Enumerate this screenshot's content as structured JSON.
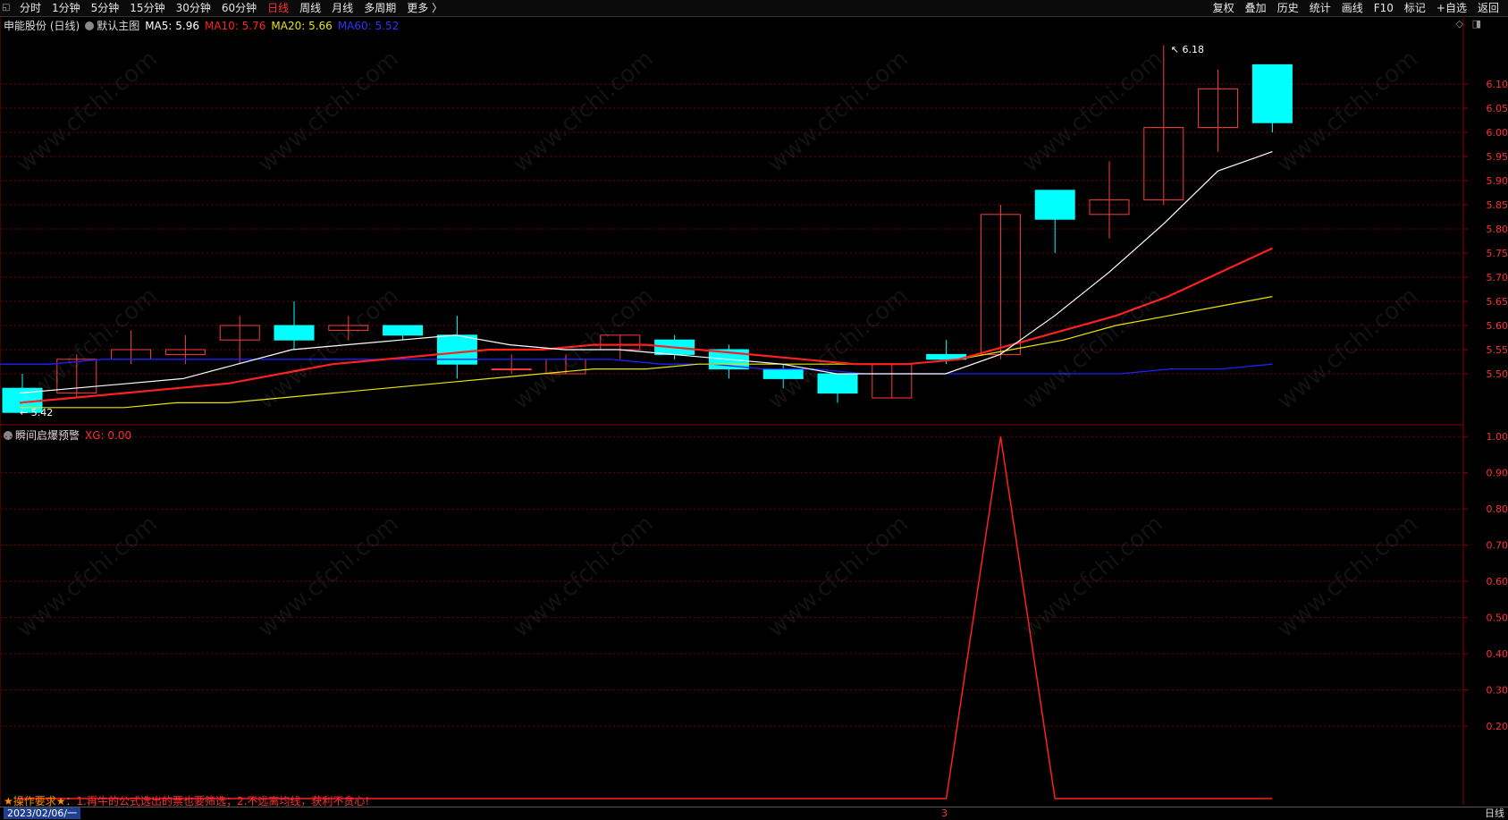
{
  "toolbar": {
    "periods": [
      "分时",
      "1分钟",
      "5分钟",
      "15分钟",
      "30分钟",
      "60分钟",
      "日线",
      "周线",
      "月线",
      "多周期",
      "更多 〉"
    ],
    "active_period": "日线",
    "actions": [
      "复权",
      "叠加",
      "历史",
      "统计",
      "画线",
      "F10",
      "标记",
      "+自选",
      "返回"
    ]
  },
  "main_legend": {
    "stock": "申能股份 (日线)",
    "indicator": "默认主图",
    "ma5": "MA5: 5.96",
    "ma10": "MA10: 5.76",
    "ma20": "MA20: 5.66",
    "ma60": "MA60: 5.52"
  },
  "sub_legend": {
    "indicator": "瞬间启爆预警",
    "xg": "XG: 0.00"
  },
  "colors": {
    "up": "#ff3b3b",
    "down": "#00ffff",
    "ma5": "#ffffff",
    "ma10": "#ff2020",
    "ma20": "#e6e600",
    "ma60": "#2020ff",
    "grid": "#7a0000",
    "axis_text": "#ff3030"
  },
  "chart_data": [
    {
      "type": "candlestick",
      "ylim": [
        5.4,
        6.2
      ],
      "y_ticks": [
        "6.10",
        "6.05",
        "6.00",
        "5.95",
        "5.90",
        "5.85",
        "5.80",
        "5.75",
        "5.70",
        "5.65",
        "5.60",
        "5.55",
        "5.50"
      ],
      "high_label": "6.18",
      "low_label": "5.42",
      "candles": [
        {
          "open": 5.47,
          "close": 5.42,
          "high": 5.5,
          "low": 5.42
        },
        {
          "open": 5.46,
          "close": 5.53,
          "high": 5.54,
          "low": 5.45
        },
        {
          "open": 5.53,
          "close": 5.55,
          "high": 5.59,
          "low": 5.52
        },
        {
          "open": 5.54,
          "close": 5.55,
          "high": 5.58,
          "low": 5.52
        },
        {
          "open": 5.57,
          "close": 5.6,
          "high": 5.62,
          "low": 5.52
        },
        {
          "open": 5.6,
          "close": 5.57,
          "high": 5.65,
          "low": 5.55
        },
        {
          "open": 5.59,
          "close": 5.6,
          "high": 5.62,
          "low": 5.57
        },
        {
          "open": 5.6,
          "close": 5.58,
          "high": 5.6,
          "low": 5.57
        },
        {
          "open": 5.58,
          "close": 5.52,
          "high": 5.62,
          "low": 5.49
        },
        {
          "open": 5.51,
          "close": 5.51,
          "high": 5.54,
          "low": 5.5
        },
        {
          "open": 5.5,
          "close": 5.53,
          "high": 5.54,
          "low": 5.5
        },
        {
          "open": 5.55,
          "close": 5.58,
          "high": 5.58,
          "low": 5.53
        },
        {
          "open": 5.57,
          "close": 5.54,
          "high": 5.58,
          "low": 5.53
        },
        {
          "open": 5.55,
          "close": 5.51,
          "high": 5.56,
          "low": 5.49
        },
        {
          "open": 5.51,
          "close": 5.49,
          "high": 5.52,
          "low": 5.47
        },
        {
          "open": 5.5,
          "close": 5.46,
          "high": 5.5,
          "low": 5.44
        },
        {
          "open": 5.45,
          "close": 5.52,
          "high": 5.52,
          "low": 5.45
        },
        {
          "open": 5.54,
          "close": 5.53,
          "high": 5.57,
          "low": 5.52
        },
        {
          "open": 5.54,
          "close": 5.83,
          "high": 5.85,
          "low": 5.53
        },
        {
          "open": 5.88,
          "close": 5.82,
          "high": 5.88,
          "low": 5.75
        },
        {
          "open": 5.83,
          "close": 5.86,
          "high": 5.94,
          "low": 5.78
        },
        {
          "open": 5.86,
          "close": 6.01,
          "high": 6.18,
          "low": 5.85
        },
        {
          "open": 6.01,
          "close": 6.09,
          "high": 6.13,
          "low": 5.96
        },
        {
          "open": 6.14,
          "close": 6.02,
          "high": 6.14,
          "low": 6.0
        }
      ],
      "ma5": [
        5.46,
        5.47,
        5.48,
        5.49,
        5.52,
        5.55,
        5.56,
        5.57,
        5.58,
        5.56,
        5.55,
        5.55,
        5.54,
        5.53,
        5.52,
        5.5,
        5.5,
        5.5,
        5.54,
        5.62,
        5.71,
        5.81,
        5.92,
        5.96
      ],
      "ma10": [
        5.44,
        5.45,
        5.46,
        5.47,
        5.48,
        5.5,
        5.52,
        5.53,
        5.54,
        5.55,
        5.55,
        5.56,
        5.56,
        5.55,
        5.54,
        5.53,
        5.52,
        5.52,
        5.53,
        5.56,
        5.59,
        5.62,
        5.66,
        5.71,
        5.76
      ],
      "ma20": [
        5.43,
        5.43,
        5.43,
        5.44,
        5.44,
        5.45,
        5.46,
        5.47,
        5.48,
        5.49,
        5.5,
        5.51,
        5.51,
        5.52,
        5.52,
        5.52,
        5.52,
        5.52,
        5.53,
        5.55,
        5.57,
        5.6,
        5.62,
        5.64,
        5.66
      ],
      "ma60": [
        5.52,
        5.52,
        5.53,
        5.53,
        5.53,
        5.53,
        5.53,
        5.53,
        5.53,
        5.53,
        5.53,
        5.53,
        5.53,
        5.52,
        5.52,
        5.51,
        5.51,
        5.5,
        5.5,
        5.5,
        5.5,
        5.5,
        5.5,
        5.51,
        5.51,
        5.52
      ]
    },
    {
      "type": "line",
      "name": "XG",
      "ylim": [
        0,
        1.05
      ],
      "y_ticks": [
        "1.00",
        "0.90",
        "0.80",
        "0.70",
        "0.60",
        "0.50",
        "0.40",
        "0.30",
        "0.20"
      ],
      "values": [
        0,
        0,
        0,
        0,
        0,
        0,
        0,
        0,
        0,
        0,
        0,
        0,
        0,
        0,
        0,
        0,
        0,
        0,
        1,
        0,
        0,
        0,
        0,
        0
      ]
    }
  ],
  "footer": {
    "date": "2023/02/06/一",
    "marker": "3",
    "period": "日线"
  },
  "note": {
    "prefix": "★操作要求★：",
    "text": "1.再牛的公式选出的票也要筛选；2.不远离均线，获利不贪心!"
  },
  "watermark": "www.cfchi.com"
}
